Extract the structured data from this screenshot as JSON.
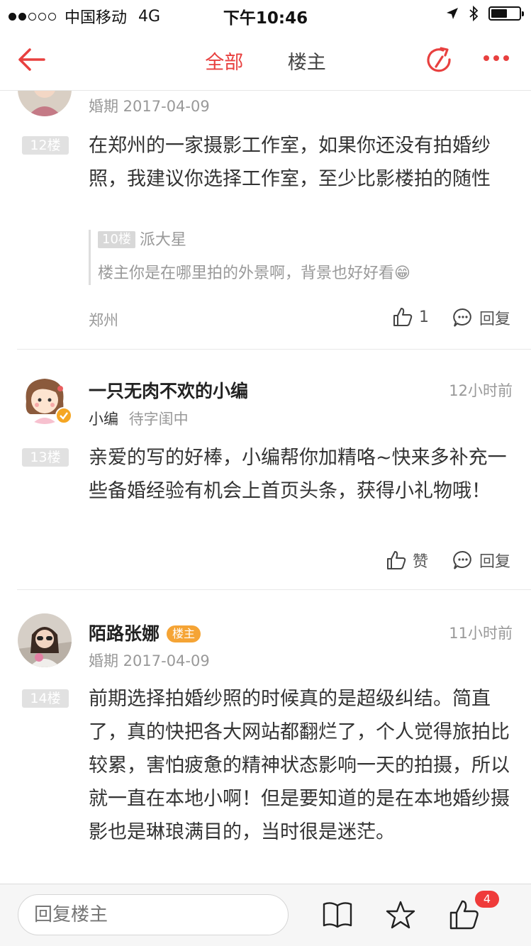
{
  "status_bar": {
    "carrier": "中国移动",
    "network": "4G",
    "time": "下午10:46"
  },
  "nav": {
    "tabs": [
      {
        "label": "全部",
        "active": true
      },
      {
        "label": "楼主",
        "active": false
      }
    ],
    "accent_color": "#e8403f"
  },
  "posts": [
    {
      "subline": "婚期 2017-04-09",
      "floor": "12楼",
      "content": "在郑州的一家摄影工作室，如果你还没有拍婚纱照，我建议你选择工作室，至少比影楼拍的随性",
      "quote": {
        "floor": "10楼",
        "author": "派大星",
        "text": "楼主你是在哪里拍的外景啊，背景也好好看😁"
      },
      "location": "郑州",
      "like_label": "1",
      "reply_label": "回复"
    },
    {
      "name": "一只无肉不欢的小编",
      "time_ago": "12小时前",
      "role": "小编",
      "status": "待字闺中",
      "floor": "13楼",
      "content": "亲爱的写的好棒，小编帮你加精咯~快来多补充一些备婚经验有机会上首页头条，获得小礼物哦！",
      "like_label": "赞",
      "reply_label": "回复"
    },
    {
      "name": "陌路张娜",
      "badge": "楼主",
      "time_ago": "11小时前",
      "subline": "婚期 2017-04-09",
      "floor": "14楼",
      "content": "前期选择拍婚纱照的时候真的是超级纠结。简直了，真的快把各大网站都翻烂了，个人觉得旅拍比较累，害怕疲惫的精神状态影响一天的拍摄，所以就一直在本地小啊！但是要知道的是在本地婚纱摄影也是琳琅满目的，当时很是迷茫。"
    }
  ],
  "bottom_bar": {
    "reply_placeholder": "回复楼主",
    "like_count": "4",
    "icons": [
      "book-icon",
      "star-icon",
      "thumbs-up-icon"
    ]
  }
}
